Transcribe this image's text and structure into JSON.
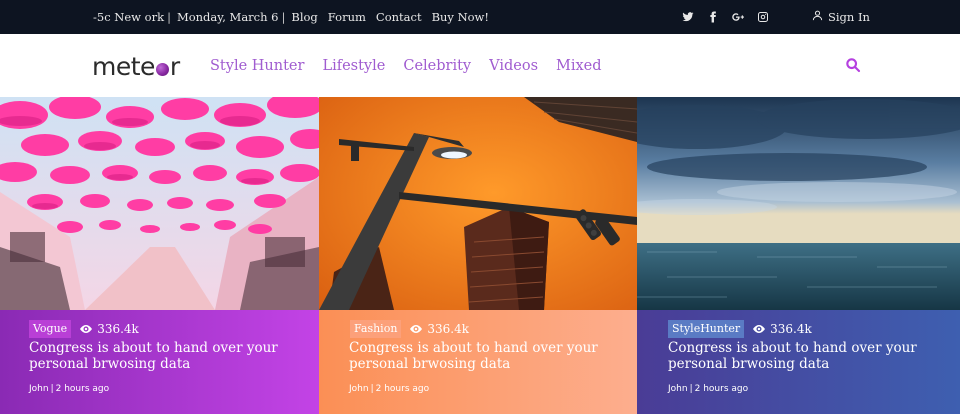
{
  "topbar": {
    "weather": "-5c New ork",
    "date": "Monday, March 6",
    "links": [
      "Blog",
      "Forum",
      "Contact",
      "Buy Now!"
    ],
    "social_icons": [
      "twitter-icon",
      "facebook-icon",
      "google-plus-icon",
      "instagram-icon"
    ],
    "signin_label": "Sign In"
  },
  "header": {
    "logo_left": "mete",
    "logo_right": "r",
    "nav": [
      "Style Hunter",
      "Lifestyle",
      "Celebrity",
      "Videos",
      "Mixed"
    ]
  },
  "cards": [
    {
      "category": "Vogue",
      "views": "336.4k",
      "title": "Congress is about to hand over your personal brwosing data",
      "author": "John",
      "time": "2 hours ago",
      "tag_color": "#b93fd6",
      "gradient": [
        "#8a2ab4",
        "#c343e6"
      ]
    },
    {
      "category": "Fashion",
      "views": "336.4k",
      "title": "Congress is about to hand over your personal brwosing data",
      "author": "John",
      "time": "2 hours ago",
      "tag_color": "#fca07a",
      "gradient": [
        "#fb8f55",
        "#fdae8e"
      ]
    },
    {
      "category": "StyleHunter",
      "views": "336.4k",
      "title": "Congress is about to hand over your personal brwosing data",
      "author": "John",
      "time": "2 hours ago",
      "tag_color": "#5a7bc4",
      "gradient": [
        "#4a3c96",
        "#3e5fb0"
      ]
    }
  ],
  "colors": {
    "topbar_bg": "#0d1421",
    "nav_link": "#a05cd0",
    "accent": "#b540e0"
  }
}
